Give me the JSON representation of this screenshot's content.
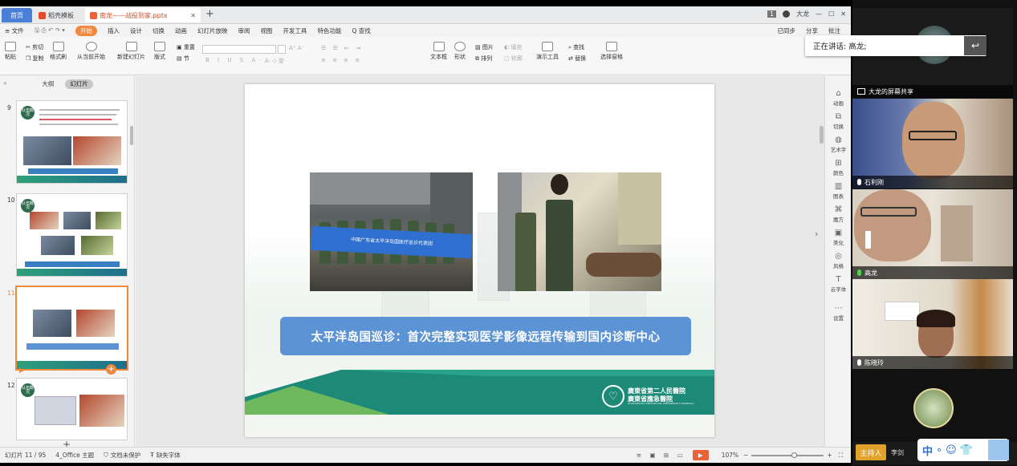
{
  "tabs": {
    "home": "首页",
    "template": "稻壳模板",
    "doc": "南龙——战役到家.pptx"
  },
  "window_right": {
    "badge": "1",
    "user": "大龙"
  },
  "menu": {
    "file": "≡ 文件",
    "items": [
      "开始",
      "插入",
      "设计",
      "切换",
      "动画",
      "幻灯片放映",
      "审阅",
      "视图",
      "开发工具",
      "特色功能"
    ],
    "search": "Q 查找",
    "sync": "已同步",
    "share": "分享",
    "annotate": "批注"
  },
  "ribbon": {
    "paste": "粘贴",
    "cut": "剪切",
    "copy": "复制",
    "format_painter": "格式刷",
    "from_current": "从当前开始",
    "new_slide": "新建幻灯片",
    "layout": "版式",
    "reset": "重置",
    "section": "节",
    "textbox": "文本框",
    "shape": "形状",
    "picture": "图片",
    "fill": "填充",
    "arrange": "排列",
    "outline": "轮廓",
    "present_tools": "演示工具",
    "find": "查找",
    "replace": "替换",
    "select_pane": "选择窗格"
  },
  "panel": {
    "outline_tab": "大纲",
    "slides_tab": "幻灯片",
    "add": "+"
  },
  "thumbs": [
    {
      "num": "9",
      "badge": "队伍概况"
    },
    {
      "num": "10",
      "badge": "队伍概况"
    },
    {
      "num": "11",
      "badge": ""
    },
    {
      "num": "12",
      "badge": "队伍概况"
    }
  ],
  "slide": {
    "banner": "中国广东省太平洋岛国医疗巡诊代表团",
    "title": "太平洋岛国巡诊：首次完整实现医学影像远程传输到国内诊断中心",
    "hospital_cn1": "廣東省第二人民醫院",
    "hospital_cn2": "廣東省應急醫院",
    "hospital_en": "GUANGDONG PROVINCIAL EMERGENCY HOSPITAL"
  },
  "right_toolbar": [
    "动画",
    "切换",
    "艺术字",
    "颜色",
    "图表",
    "魔方",
    "美化",
    "风格",
    "云字体",
    "设置"
  ],
  "status": {
    "slide": "幻灯片 11 / 95",
    "theme": "4_Office 主题",
    "protect": "文档未保护",
    "font": "缺失字体",
    "zoom": "107%"
  },
  "meeting": {
    "speaking_label": "正在讲话: 高龙;",
    "share_name": "大龙的屏幕共享",
    "participants": [
      "石利刚",
      "高龙",
      "陈晓玲"
    ],
    "host_label": "主持人",
    "host_name": "李剑",
    "ime": "中"
  },
  "colors": {
    "accent": "#f0883e",
    "title_box": "#5b93d4",
    "teal": "#1d8a78",
    "tab_blue": "#4a7fd8"
  }
}
